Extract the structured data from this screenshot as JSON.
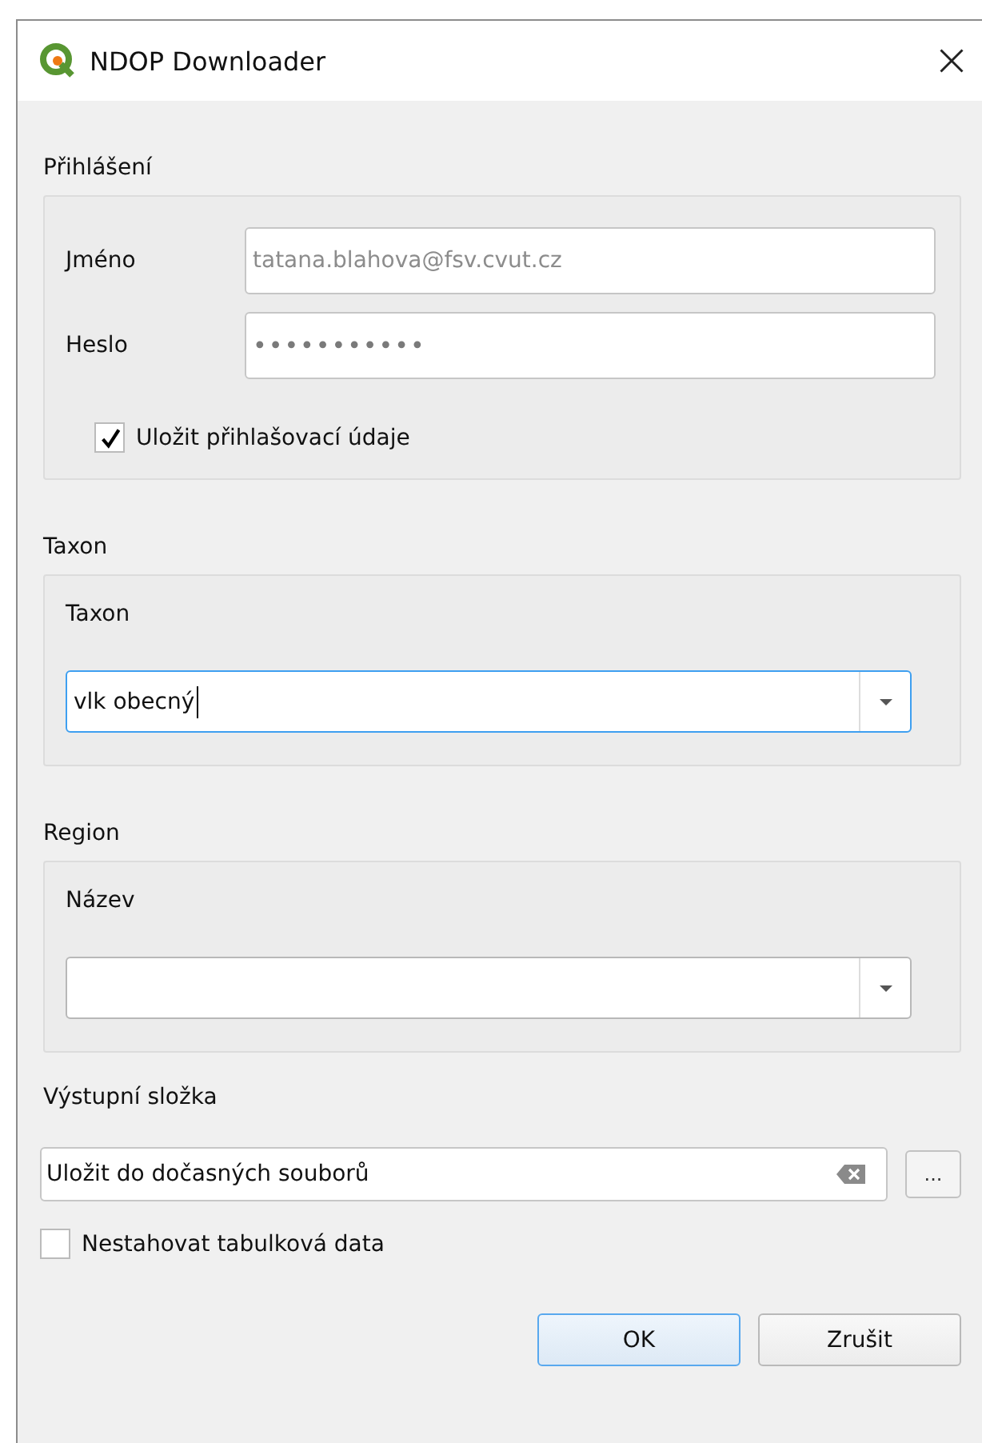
{
  "window": {
    "title": "NDOP Downloader"
  },
  "login": {
    "title": "Přihlášení",
    "fields": [
      {
        "label": "Jméno",
        "value": "tatana.blahova@fsv.cvut.cz",
        "kind": "email"
      },
      {
        "label": "Heslo",
        "value": "•••••••••••",
        "kind": "password"
      }
    ],
    "remember": {
      "label": "Uložit přihlašovací údaje",
      "checked": true
    }
  },
  "taxon": {
    "title": "Taxon",
    "label": "Taxon",
    "value": "vlk obecný",
    "focused": true
  },
  "region": {
    "title": "Region",
    "label": "Název",
    "focused": false
  },
  "output": {
    "title": "Výstupní složka",
    "value": "Uložit do dočasných souborů",
    "browse": "..."
  },
  "skip_table": {
    "label": "Nestahovat tabulková data",
    "checked": false
  },
  "buttons": [
    {
      "label": "OK",
      "default": true
    },
    {
      "label": "Zrušit",
      "default": false
    }
  ]
}
